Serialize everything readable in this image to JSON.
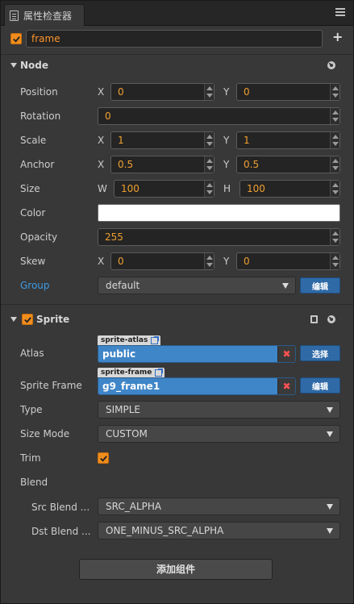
{
  "tab": {
    "title": "属性检查器",
    "icon": "inspector-icon"
  },
  "node_name": {
    "value": "frame",
    "enabled": true
  },
  "node_section": {
    "title": "Node",
    "position": {
      "label": "Position",
      "x_label": "X",
      "x": "0",
      "y_label": "Y",
      "y": "0"
    },
    "rotation": {
      "label": "Rotation",
      "value": "0"
    },
    "scale": {
      "label": "Scale",
      "x_label": "X",
      "x": "1",
      "y_label": "Y",
      "y": "1"
    },
    "anchor": {
      "label": "Anchor",
      "x_label": "X",
      "x": "0.5",
      "y_label": "Y",
      "y": "0.5"
    },
    "size": {
      "label": "Size",
      "w_label": "W",
      "w": "100",
      "h_label": "H",
      "h": "100"
    },
    "color": {
      "label": "Color",
      "value": "#ffffff"
    },
    "opacity": {
      "label": "Opacity",
      "value": "255"
    },
    "skew": {
      "label": "Skew",
      "x_label": "X",
      "x": "0",
      "y_label": "Y",
      "y": "0"
    },
    "group": {
      "label": "Group",
      "value": "default",
      "edit_label": "编辑"
    }
  },
  "sprite_section": {
    "title": "Sprite",
    "enabled": true,
    "atlas": {
      "label": "Atlas",
      "type_tag": "sprite-atlas",
      "value": "public",
      "select_label": "选择"
    },
    "sprite_frame": {
      "label": "Sprite Frame",
      "type_tag": "sprite-frame",
      "value": "g9_frame1",
      "edit_label": "编辑"
    },
    "type": {
      "label": "Type",
      "value": "SIMPLE"
    },
    "size_mode": {
      "label": "Size Mode",
      "value": "CUSTOM"
    },
    "trim": {
      "label": "Trim",
      "checked": true
    },
    "blend": {
      "label": "Blend"
    },
    "src_blend": {
      "label": "Src Blend ...",
      "value": "SRC_ALPHA"
    },
    "dst_blend": {
      "label": "Dst Blend ...",
      "value": "ONE_MINUS_SRC_ALPHA"
    }
  },
  "add_component": {
    "label": "添加组件"
  },
  "colors": {
    "accent": "#f08d1e",
    "value_text": "#f0a030",
    "link": "#3d9be6",
    "button_blue": "#2f6aa7",
    "asset_blue": "#3f86c8",
    "clear_red": "#ff5151"
  }
}
